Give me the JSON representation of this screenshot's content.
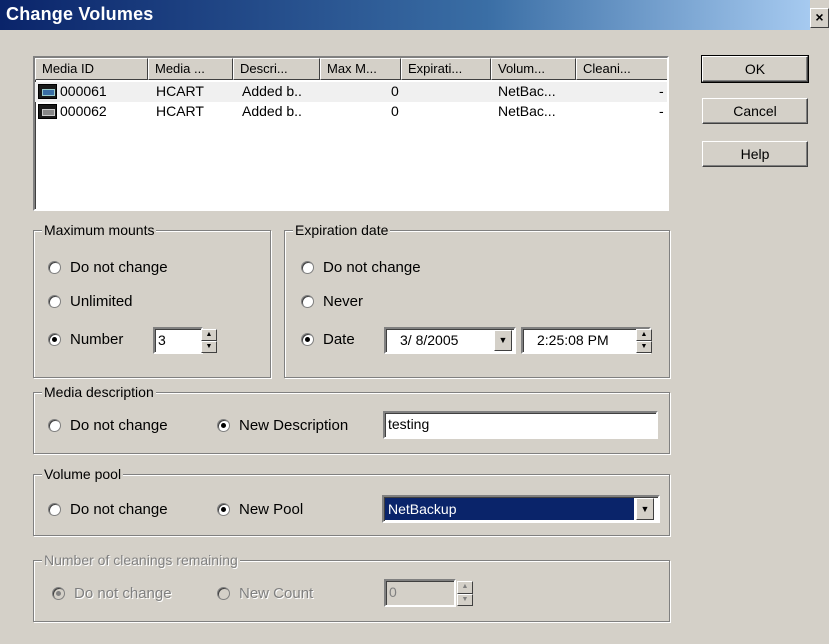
{
  "window": {
    "title": "Change Volumes",
    "close_label": "×"
  },
  "buttons": {
    "ok": "OK",
    "cancel": "Cancel",
    "help": "Help"
  },
  "list": {
    "columns": [
      "Media ID",
      "Media ...",
      "Descri...",
      "Max M...",
      "Expirati...",
      "Volum...",
      "Cleani..."
    ],
    "rows": [
      {
        "media_id": "000061",
        "media_type": "HCART",
        "description": "Added b..",
        "max_mounts": "0",
        "expiration": "",
        "volume_pool": "NetBac...",
        "cleanings": "-"
      },
      {
        "media_id": "000062",
        "media_type": "HCART",
        "description": "Added b..",
        "max_mounts": "0",
        "expiration": "",
        "volume_pool": "NetBac...",
        "cleanings": "-"
      }
    ]
  },
  "max_mounts": {
    "label": "Maximum mounts",
    "opt_no_change": "Do not change",
    "opt_unlimited": "Unlimited",
    "opt_number": "Number",
    "number_value": "3",
    "selected": "number"
  },
  "expiration": {
    "label": "Expiration date",
    "opt_no_change": "Do not change",
    "opt_never": "Never",
    "opt_date": "Date",
    "date_value": "3/ 8/2005",
    "time_value": "2:25:08 PM",
    "selected": "date"
  },
  "media_description": {
    "label": "Media description",
    "opt_no_change": "Do not change",
    "opt_new": "New Description",
    "value": "testing",
    "selected": "new"
  },
  "volume_pool": {
    "label": "Volume pool",
    "opt_no_change": "Do not change",
    "opt_new": "New Pool",
    "value": "NetBackup",
    "selected": "new"
  },
  "cleanings": {
    "label": "Number of cleanings remaining",
    "opt_no_change": "Do not change",
    "opt_new": "New Count",
    "value": "0",
    "selected": "no_change",
    "enabled": false
  },
  "colors": {
    "title_start": "#0a246a",
    "title_end": "#a6caf0",
    "selection": "#0a246a",
    "face": "#d4d0c8"
  }
}
